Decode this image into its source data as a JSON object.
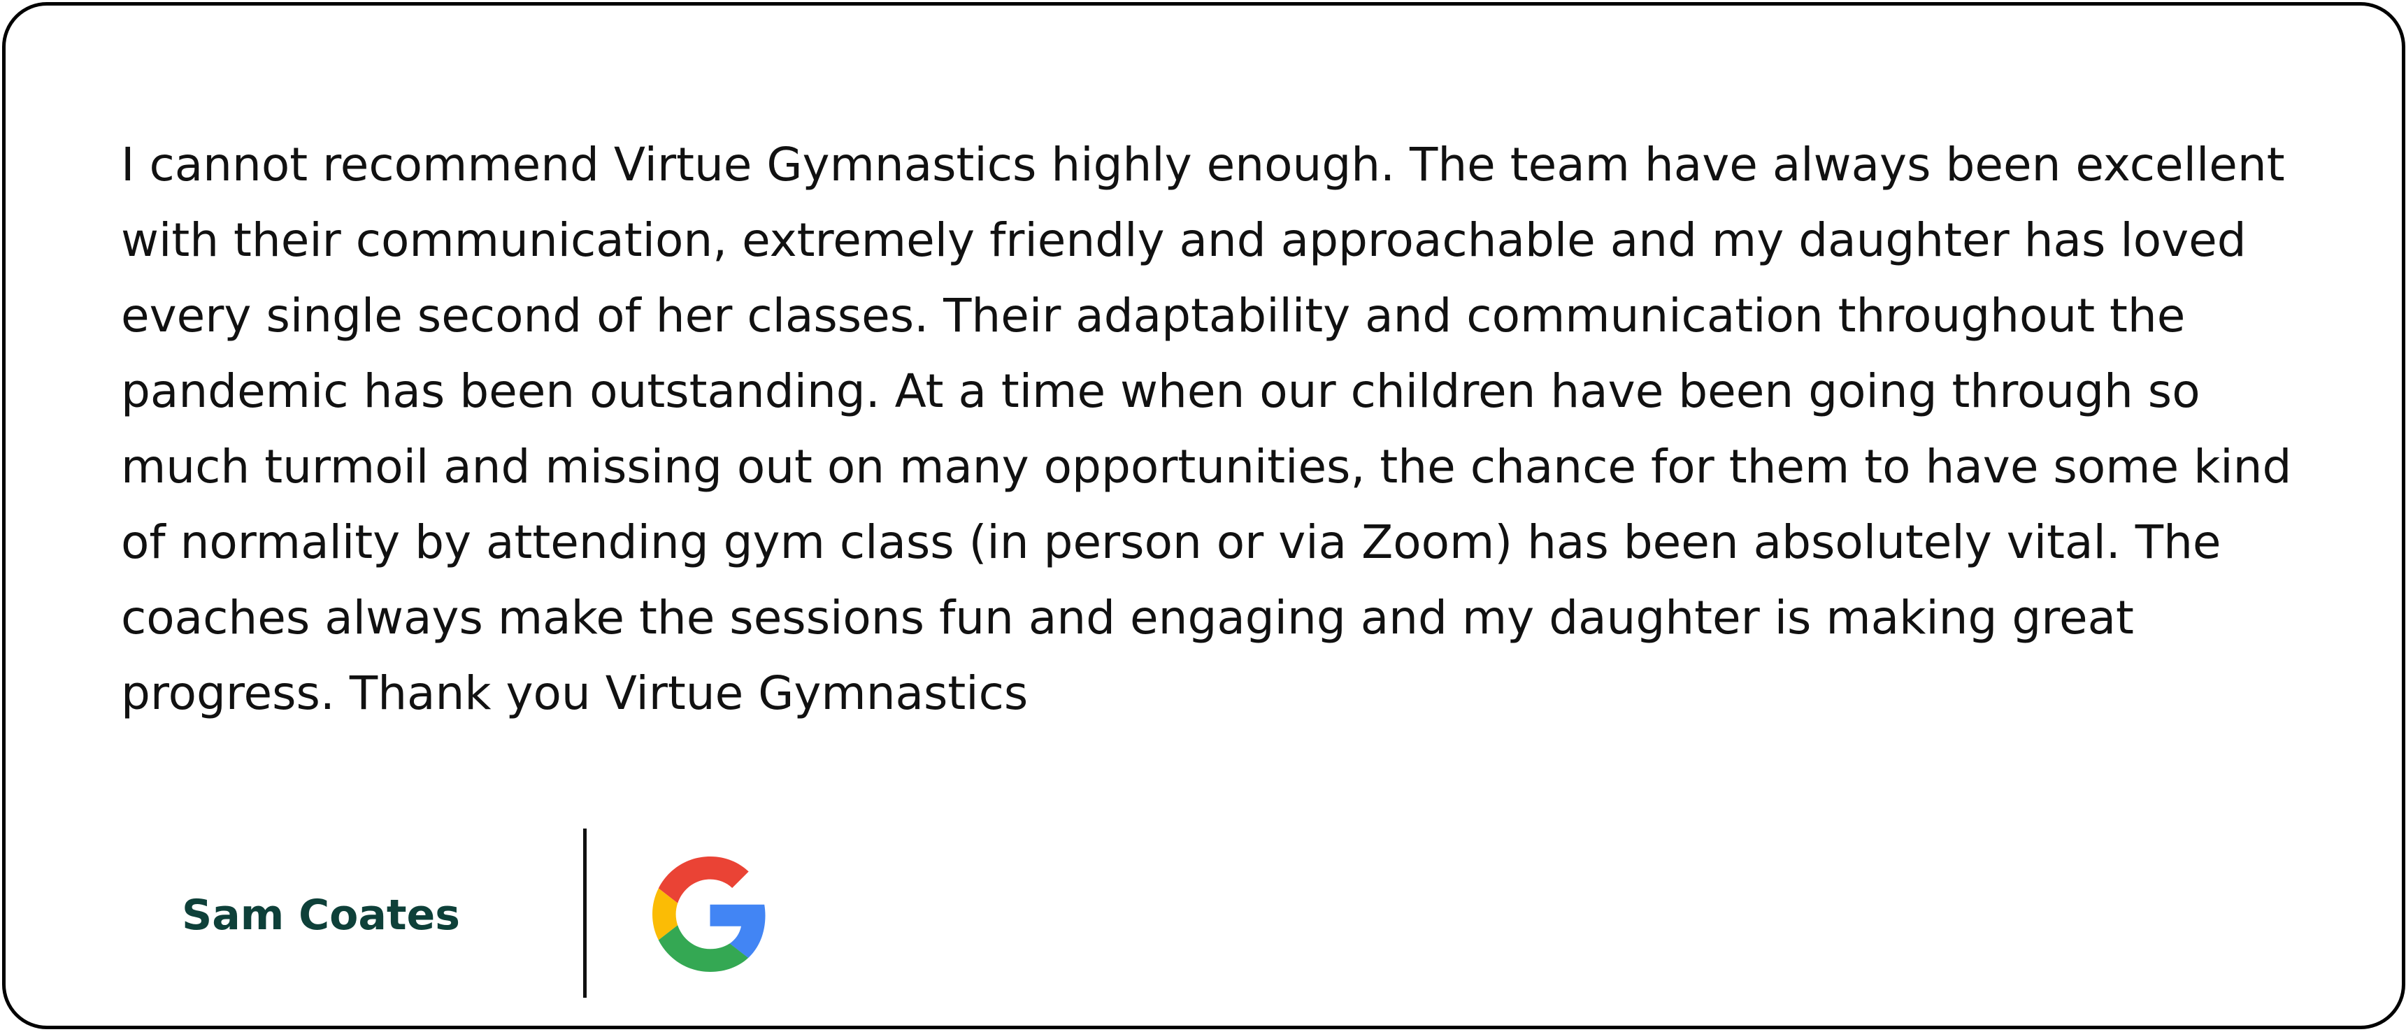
{
  "review": {
    "text": "I cannot recommend Virtue Gymnastics highly enough. The team have always been excellent with their communication, extremely friendly and approachable and my daughter has loved every single second of her classes. Their adaptability and communication throughout the pandemic has been outstanding. At a time when our children have been going through so much turmoil and missing out on many opportunities, the chance for them to have some kind of normality by attending gym class (in person or via Zoom) has been absolutely vital. The coaches always make the sessions fun and engaging and my daughter is making great progress. Thank you Virtue Gymnastics",
    "reviewer_name": "Sam Coates",
    "source_icon": "google-logo-icon"
  },
  "colors": {
    "card_border": "#000000",
    "text": "#111111",
    "reviewer_name": "#0e4039",
    "google_blue": "#4285F4",
    "google_red": "#EA4335",
    "google_yellow": "#FBBC05",
    "google_green": "#34A853"
  }
}
